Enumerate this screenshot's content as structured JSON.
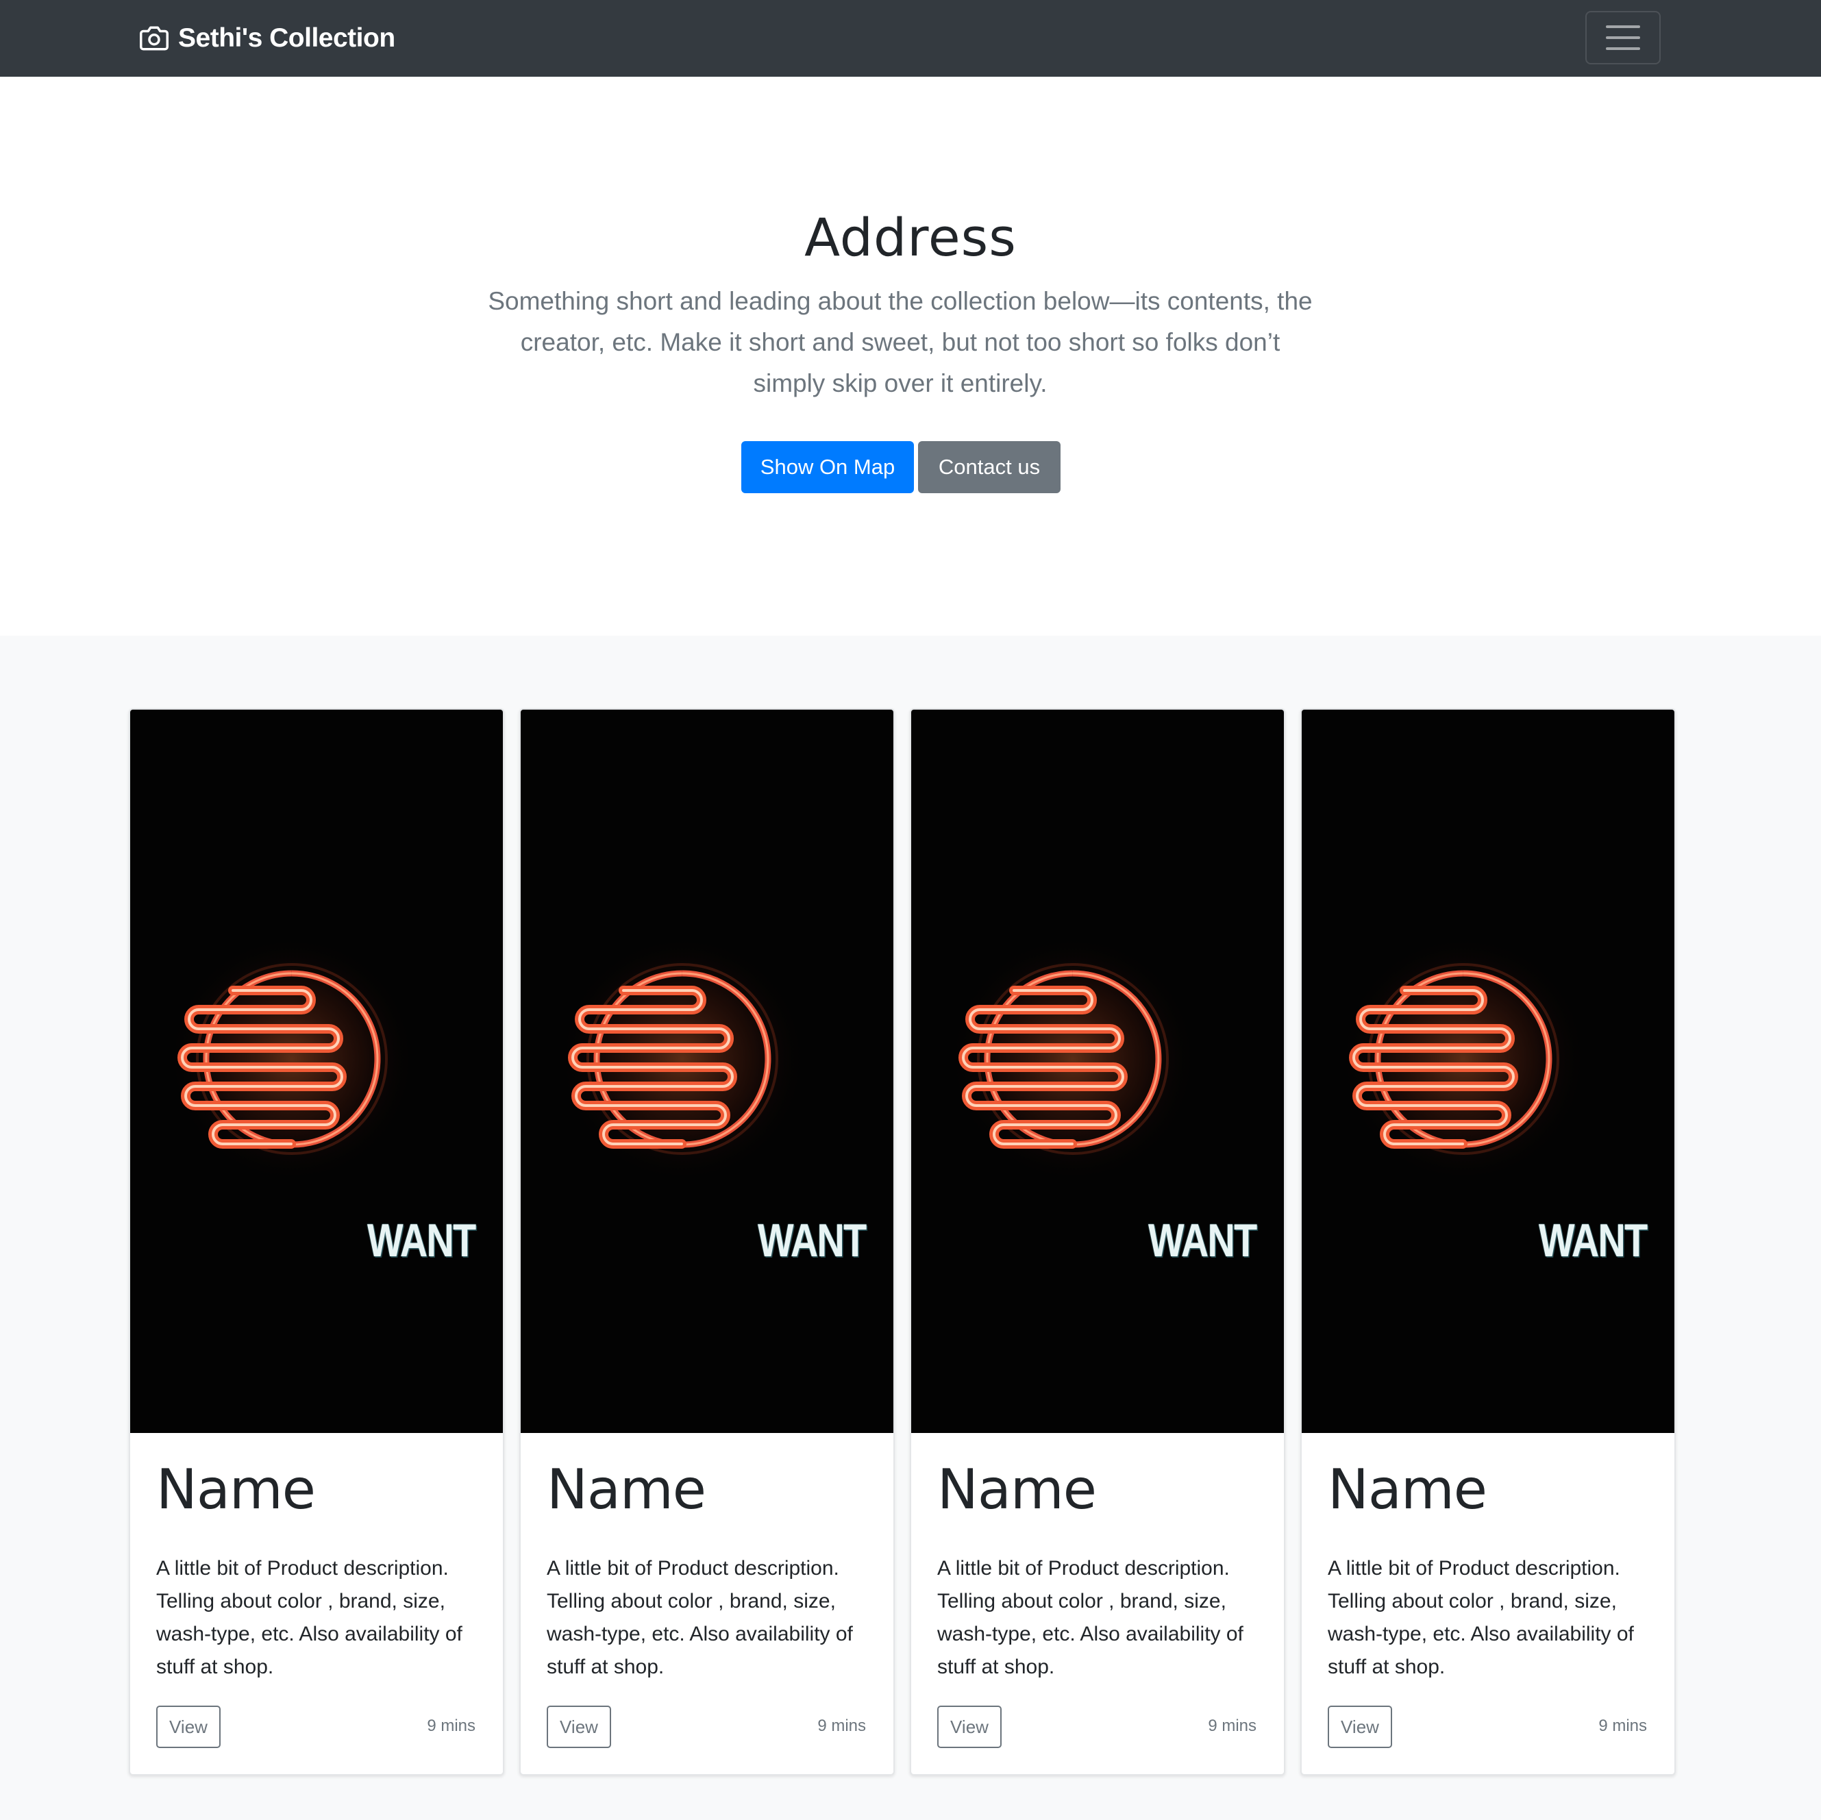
{
  "navbar": {
    "brand": "Sethi's Collection",
    "brand_icon": "camera-icon",
    "toggler_icon": "hamburger-menu-icon"
  },
  "hero": {
    "title": "Address",
    "lead": "Something short and leading about the collection below—its contents, the creator, etc. Make it short and sweet, but not too short so folks don’t simply skip over it entirely.",
    "primary_button": "Show On Map",
    "secondary_button": "Contact us"
  },
  "colors": {
    "navbar_bg": "#343a40",
    "primary": "#007bff",
    "secondary": "#6c757d",
    "album_bg": "#f8f9fa"
  },
  "cards": [
    {
      "image_text": "WANT",
      "title": "Name",
      "text": "A little bit of Product description. Telling about color , brand, size, wash-type, etc. Also availability of stuff at shop.",
      "button": "View",
      "meta": "9 mins"
    },
    {
      "image_text": "WANT",
      "title": "Name",
      "text": "A little bit of Product description. Telling about color , brand, size, wash-type, etc. Also availability of stuff at shop.",
      "button": "View",
      "meta": "9 mins"
    },
    {
      "image_text": "WANT",
      "title": "Name",
      "text": "A little bit of Product description. Telling about color , brand, size, wash-type, etc. Also availability of stuff at shop.",
      "button": "View",
      "meta": "9 mins"
    },
    {
      "image_text": "WANT",
      "title": "Name",
      "text": "A little bit of Product description. Telling about color , brand, size, wash-type, etc. Also availability of stuff at shop.",
      "button": "View",
      "meta": "9 mins"
    }
  ]
}
